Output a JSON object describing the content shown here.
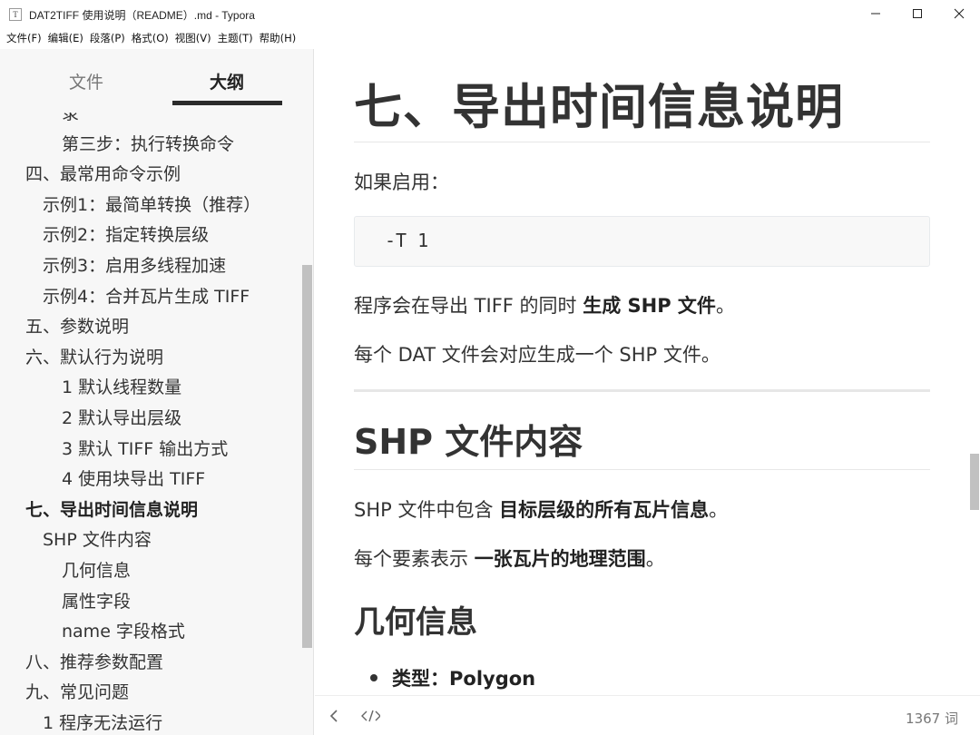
{
  "window": {
    "app_icon_letter": "T",
    "title": "DAT2TIFF 使用说明（README）.md - Typora",
    "minimize_glyph": "—",
    "maximize_glyph": "☐",
    "close_glyph": "✕"
  },
  "menu": [
    "文件(F)",
    "编辑(E)",
    "段落(P)",
    "格式(O)",
    "视图(V)",
    "主题(T)",
    "帮助(H)"
  ],
  "sidebar": {
    "tabs": {
      "files": "文件",
      "outline": "大纲"
    },
    "outline_items": [
      {
        "label": "录",
        "level": 3,
        "active": false
      },
      {
        "label": "第三步：执行转换命令",
        "level": 3,
        "active": false
      },
      {
        "label": "四、最常用命令示例",
        "level": 1,
        "active": false
      },
      {
        "label": "示例1：最简单转换（推荐）",
        "level": 2,
        "active": false
      },
      {
        "label": "示例2：指定转换层级",
        "level": 2,
        "active": false
      },
      {
        "label": "示例3：启用多线程加速",
        "level": 2,
        "active": false
      },
      {
        "label": "示例4：合并瓦片生成 TIFF",
        "level": 2,
        "active": false
      },
      {
        "label": "五、参数说明",
        "level": 1,
        "active": false
      },
      {
        "label": "六、默认行为说明",
        "level": 1,
        "active": false
      },
      {
        "label": "1 默认线程数量",
        "level": 3,
        "active": false
      },
      {
        "label": "2 默认导出层级",
        "level": 3,
        "active": false
      },
      {
        "label": "3 默认 TIFF 输出方式",
        "level": 3,
        "active": false
      },
      {
        "label": "4 使用块导出 TIFF",
        "level": 3,
        "active": false
      },
      {
        "label": "七、导出时间信息说明",
        "level": 1,
        "active": true
      },
      {
        "label": "SHP 文件内容",
        "level": 2,
        "active": false
      },
      {
        "label": "几何信息",
        "level": 3,
        "active": false
      },
      {
        "label": "属性字段",
        "level": 3,
        "active": false
      },
      {
        "label": "name 字段格式",
        "level": 3,
        "active": false
      },
      {
        "label": "八、推荐参数配置",
        "level": 1,
        "active": false
      },
      {
        "label": "九、常见问题",
        "level": 1,
        "active": false
      },
      {
        "label": "1 程序无法运行",
        "level": 2,
        "active": false
      }
    ]
  },
  "editor": {
    "h1": "七、导出时间信息说明",
    "p_if_enabled": "如果启用：",
    "code": "-T 1",
    "p_shp_generate_pre": "程序会在导出 TIFF 的同时 ",
    "p_shp_generate_bold": "生成 SHP 文件",
    "p_shp_generate_post": "。",
    "p_each_dat": "每个 DAT 文件会对应生成一个 SHP 文件。",
    "h2": "SHP 文件内容",
    "p_contains_pre": "SHP 文件中包含 ",
    "p_contains_bold": "目标层级的所有瓦片信息",
    "p_contains_post": "。",
    "p_each_feature_pre": "每个要素表示 ",
    "p_each_feature_bold": "一张瓦片的地理范围",
    "p_each_feature_post": "。",
    "h3": "几何信息",
    "li_type": "类型：Polygon"
  },
  "footer": {
    "back_glyph": "<",
    "source_glyph": "</>",
    "word_count": "1367 词"
  }
}
